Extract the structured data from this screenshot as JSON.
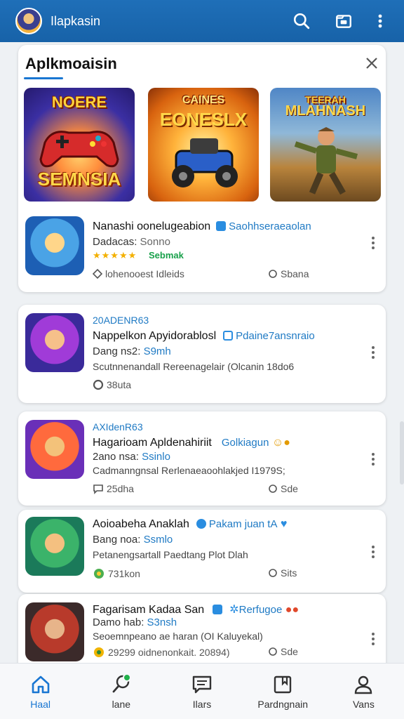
{
  "appbar": {
    "title": "Ilapkasin"
  },
  "section": {
    "title": "Aplkmoaisin"
  },
  "banners": [
    {
      "title": "NOERE",
      "subtitle": "",
      "bottom": "SEMNSIA"
    },
    {
      "title": "CAINES",
      "subtitle": "EONESLX",
      "bottom": ""
    },
    {
      "title": "TEERAH",
      "subtitle": "MLAHNASH",
      "bottom": ""
    }
  ],
  "featured": {
    "name": "Nanashi oonelugeabion",
    "dev": "Saohhseraeaolan",
    "sub_a": "Dadacas:",
    "sub_b": "Sonno",
    "tag": "Sebmak",
    "meta_left": "lohenooest Idleids",
    "meta_right": "Sbana"
  },
  "cards": [
    {
      "tag": "20ADENR63",
      "name": "Nappelkon Apyidorablosl",
      "dev": "Pdaine7ansnraio",
      "sub_a": "Dang ns2:",
      "sub_b": "S9mh",
      "desc": "Scutnnenandall Rereenagelair (Olcanin 18do6",
      "meta_left": "38uta",
      "meta_right": ""
    },
    {
      "tag": "AXIdenR63",
      "name": "Hagarioam Apldenahiriit",
      "dev": "Golkiagun",
      "sub_a": "2ano nsa:",
      "sub_b": "Ssinlo",
      "desc": "Cadmanngnsal Rerlenaeaoohlakjed I1979S;",
      "meta_left": "25dha",
      "meta_right": "Sde"
    },
    {
      "tag": "",
      "name": "Aoioabeha Anaklah",
      "dev": "Pakam juan tA",
      "sub_a": "Bang noa:",
      "sub_b": "Ssmlo",
      "desc": "Petanengsartall Paedtang Plot Dlah",
      "meta_left": "731kon",
      "meta_right": "Sits"
    },
    {
      "tag": "",
      "name": "Fagarisam Kadaa San",
      "dev": "Rerfugoe",
      "sub_a": "Damo hab:",
      "sub_b": "S3nsh",
      "desc": "Seoemnpeano ae haran (OI Kaluyekal)",
      "meta_left": "29299 oidnenonkait. 20894)",
      "meta_right": "Sde"
    }
  ],
  "nav": [
    {
      "label": "Haal"
    },
    {
      "label": "lane"
    },
    {
      "label": "Ilars"
    },
    {
      "label": "Pardngnain"
    },
    {
      "label": "Vans"
    }
  ]
}
